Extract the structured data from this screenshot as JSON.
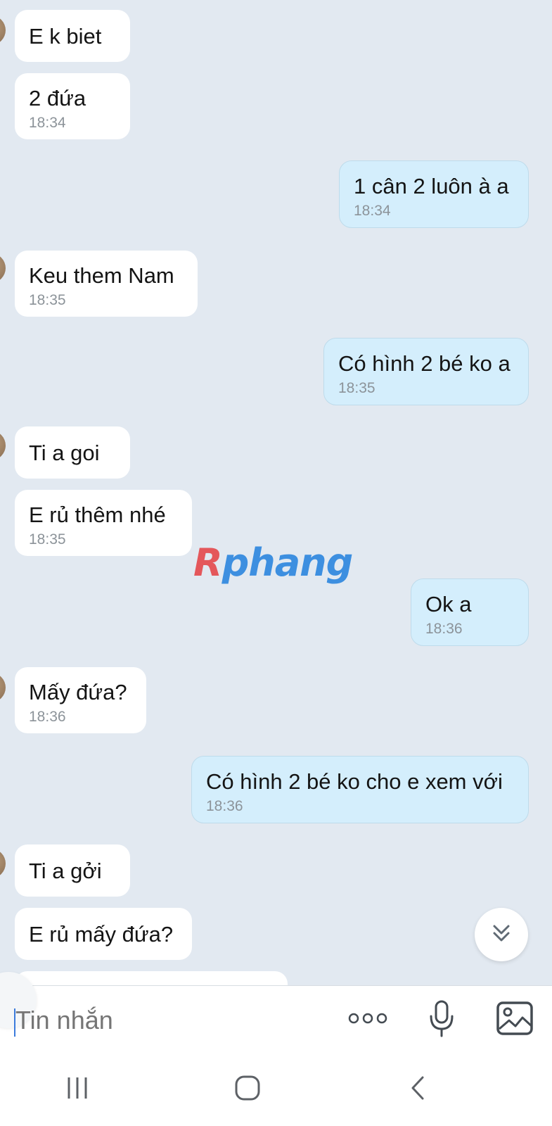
{
  "messages": [
    {
      "dir": "in",
      "text": "E k biet",
      "time": ""
    },
    {
      "dir": "in",
      "text": "2 đứa",
      "time": "18:34"
    },
    {
      "dir": "out",
      "text": "1 cân 2 luôn à a",
      "time": "18:34"
    },
    {
      "dir": "in",
      "text": "Keu them Nam",
      "time": "18:35"
    },
    {
      "dir": "out",
      "text": "Có hình 2 bé ko a",
      "time": "18:35"
    },
    {
      "dir": "in",
      "text": "Ti a goi",
      "time": ""
    },
    {
      "dir": "in",
      "text": "E rủ thêm nhé",
      "time": "18:35"
    },
    {
      "dir": "out",
      "text": "Ok a",
      "time": "18:36"
    },
    {
      "dir": "in",
      "text": "Mấy đứa?",
      "time": "18:36"
    },
    {
      "dir": "out",
      "text": "Có hình 2 bé ko cho e xem với",
      "time": "18:36"
    },
    {
      "dir": "in",
      "text": "Ti a gởi",
      "time": ""
    },
    {
      "dir": "in",
      "text": "E rủ mấy đứa?",
      "time": ""
    }
  ],
  "watermark": {
    "first": "R",
    "rest": "phang"
  },
  "composer": {
    "placeholder": "Tin nhắn"
  },
  "icons": {
    "scroll_down": "double-chevron-down-icon",
    "more": "more-dots-icon",
    "mic": "microphone-icon",
    "image": "image-icon",
    "nav_recent": "recent-apps-icon",
    "nav_home": "home-icon",
    "nav_back": "back-icon"
  },
  "colors": {
    "chat_bg": "#e2e9f1",
    "incoming_bubble": "#ffffff",
    "outgoing_bubble": "#d4eefc",
    "timestamp": "#8c9399"
  }
}
